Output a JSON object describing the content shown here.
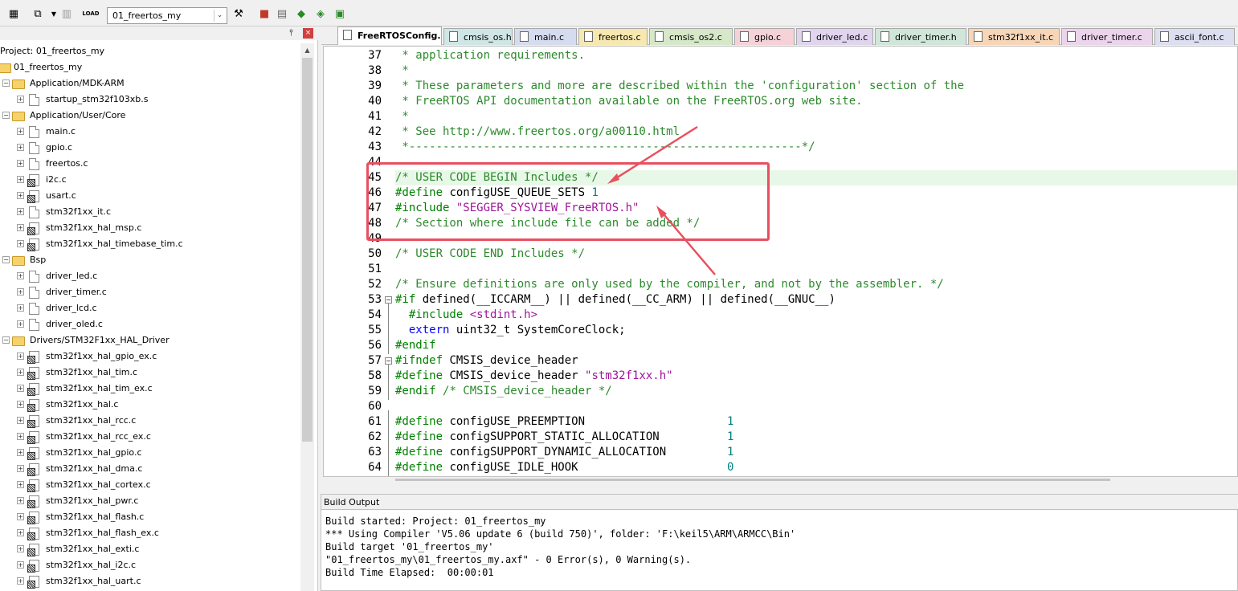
{
  "toolbar": {
    "target": "01_freertos_my",
    "icons": [
      "translate-icon",
      "build-icon",
      "rebuild-icon",
      "batch-icon",
      "load-icon",
      "target-options-icon",
      "manage-icon",
      "select-packs-icon",
      "pack-installer-icon",
      "run-icon",
      "extra-icon"
    ],
    "load_label": "LOAD"
  },
  "project": {
    "title": "Project: 01_freertos_my",
    "root": "01_freertos_my",
    "pin": "ᵠ",
    "close": "×",
    "items": [
      {
        "label": "Application/MDK-ARM",
        "type": "group"
      },
      {
        "label": "startup_stm32f103xb.s",
        "type": "file"
      },
      {
        "label": "Application/User/Core",
        "type": "group"
      },
      {
        "label": "main.c",
        "type": "file"
      },
      {
        "label": "gpio.c",
        "type": "file"
      },
      {
        "label": "freertos.c",
        "type": "file"
      },
      {
        "label": "i2c.c",
        "type": "filekey"
      },
      {
        "label": "usart.c",
        "type": "filekey"
      },
      {
        "label": "stm32f1xx_it.c",
        "type": "file"
      },
      {
        "label": "stm32f1xx_hal_msp.c",
        "type": "filekey"
      },
      {
        "label": "stm32f1xx_hal_timebase_tim.c",
        "type": "filekey"
      },
      {
        "label": "Bsp",
        "type": "group"
      },
      {
        "label": "driver_led.c",
        "type": "file"
      },
      {
        "label": "driver_timer.c",
        "type": "file"
      },
      {
        "label": "driver_lcd.c",
        "type": "file"
      },
      {
        "label": "driver_oled.c",
        "type": "file"
      },
      {
        "label": "Drivers/STM32F1xx_HAL_Driver",
        "type": "group"
      },
      {
        "label": "stm32f1xx_hal_gpio_ex.c",
        "type": "filekey"
      },
      {
        "label": "stm32f1xx_hal_tim.c",
        "type": "filekey"
      },
      {
        "label": "stm32f1xx_hal_tim_ex.c",
        "type": "filekey"
      },
      {
        "label": "stm32f1xx_hal.c",
        "type": "filekey"
      },
      {
        "label": "stm32f1xx_hal_rcc.c",
        "type": "filekey"
      },
      {
        "label": "stm32f1xx_hal_rcc_ex.c",
        "type": "filekey"
      },
      {
        "label": "stm32f1xx_hal_gpio.c",
        "type": "filekey"
      },
      {
        "label": "stm32f1xx_hal_dma.c",
        "type": "filekey"
      },
      {
        "label": "stm32f1xx_hal_cortex.c",
        "type": "filekey"
      },
      {
        "label": "stm32f1xx_hal_pwr.c",
        "type": "filekey"
      },
      {
        "label": "stm32f1xx_hal_flash.c",
        "type": "filekey"
      },
      {
        "label": "stm32f1xx_hal_flash_ex.c",
        "type": "filekey"
      },
      {
        "label": "stm32f1xx_hal_exti.c",
        "type": "filekey"
      },
      {
        "label": "stm32f1xx_hal_i2c.c",
        "type": "filekey"
      },
      {
        "label": "stm32f1xx_hal_uart.c",
        "type": "filekey"
      }
    ]
  },
  "tabs": [
    {
      "label": "FreeRTOSConfig.h",
      "color": "#ffffff",
      "active": true
    },
    {
      "label": "cmsis_os.h",
      "color": "#cfe6e6"
    },
    {
      "label": "main.c",
      "color": "#d6dcef"
    },
    {
      "label": "freertos.c",
      "color": "#f7e8b0"
    },
    {
      "label": "cmsis_os2.c",
      "color": "#d6e8c8"
    },
    {
      "label": "gpio.c",
      "color": "#f4d2d8"
    },
    {
      "label": "driver_led.c",
      "color": "#e0d4ee"
    },
    {
      "label": "driver_timer.h",
      "color": "#cfe6d8"
    },
    {
      "label": "stm32f1xx_it.c",
      "color": "#f7d6b8"
    },
    {
      "label": "driver_timer.c",
      "color": "#ecd4ec"
    },
    {
      "label": "ascii_font.c",
      "color": "#dcdff0"
    }
  ],
  "code": [
    {
      "n": "37",
      "t": [
        [
          "c-com",
          " * application requirements."
        ]
      ]
    },
    {
      "n": "38",
      "t": [
        [
          "c-com",
          " *"
        ]
      ]
    },
    {
      "n": "39",
      "t": [
        [
          "c-com",
          " * These parameters and more are described within the 'configuration' section of the"
        ]
      ]
    },
    {
      "n": "40",
      "t": [
        [
          "c-com",
          " * FreeRTOS API documentation available on the FreeRTOS.org web site."
        ]
      ]
    },
    {
      "n": "41",
      "t": [
        [
          "c-com",
          " *"
        ]
      ]
    },
    {
      "n": "42",
      "t": [
        [
          "c-com",
          " * See http://www.freertos.org/a00110.html"
        ]
      ]
    },
    {
      "n": "43",
      "t": [
        [
          "c-com",
          " *----------------------------------------------------------*/"
        ]
      ]
    },
    {
      "n": "44",
      "t": []
    },
    {
      "n": "45",
      "t": [
        [
          "c-com",
          "/* USER CODE BEGIN Includes */"
        ]
      ],
      "hl": true
    },
    {
      "n": "46",
      "t": [
        [
          "c-pp",
          "#define "
        ],
        [
          "c-tx",
          "configUSE_QUEUE_SETS "
        ],
        [
          "c-num",
          "1"
        ]
      ]
    },
    {
      "n": "47",
      "t": [
        [
          "c-pp",
          "#include "
        ],
        [
          "c-str",
          "\"SEGGER_SYSVIEW_FreeRTOS.h\""
        ]
      ]
    },
    {
      "n": "48",
      "t": [
        [
          "c-com",
          "/* Section where include file can be added */"
        ]
      ]
    },
    {
      "n": "49",
      "t": []
    },
    {
      "n": "50",
      "t": [
        [
          "c-com",
          "/* USER CODE END Includes */"
        ]
      ]
    },
    {
      "n": "51",
      "t": []
    },
    {
      "n": "52",
      "t": [
        [
          "c-com",
          "/* Ensure definitions are only used by the compiler, and not by the assembler. */"
        ]
      ]
    },
    {
      "n": "53",
      "t": [
        [
          "c-pp",
          "#if "
        ],
        [
          "c-tx",
          "defined(__ICCARM__) || defined(__CC_ARM) || defined(__GNUC__)"
        ]
      ]
    },
    {
      "n": "54",
      "t": [
        [
          "c-pp",
          "  #include "
        ],
        [
          "c-str",
          "<stdint.h>"
        ]
      ]
    },
    {
      "n": "55",
      "t": [
        [
          "c-kw",
          "  extern "
        ],
        [
          "c-tx",
          "uint32_t SystemCoreClock;"
        ]
      ]
    },
    {
      "n": "56",
      "t": [
        [
          "c-pp",
          "#endif"
        ]
      ]
    },
    {
      "n": "57",
      "t": [
        [
          "c-pp",
          "#ifndef "
        ],
        [
          "c-tx",
          "CMSIS_device_header"
        ]
      ]
    },
    {
      "n": "58",
      "t": [
        [
          "c-pp",
          "#define "
        ],
        [
          "c-tx",
          "CMSIS_device_header "
        ],
        [
          "c-str",
          "\"stm32f1xx.h\""
        ]
      ]
    },
    {
      "n": "59",
      "t": [
        [
          "c-pp",
          "#endif "
        ],
        [
          "c-com",
          "/* CMSIS_device_header */"
        ]
      ]
    },
    {
      "n": "60",
      "t": []
    },
    {
      "n": "61",
      "t": [
        [
          "c-pp",
          "#define "
        ],
        [
          "c-tx",
          "configUSE_PREEMPTION                     "
        ],
        [
          "c-num",
          "1"
        ]
      ]
    },
    {
      "n": "62",
      "t": [
        [
          "c-pp",
          "#define "
        ],
        [
          "c-tx",
          "configSUPPORT_STATIC_ALLOCATION          "
        ],
        [
          "c-num",
          "1"
        ]
      ]
    },
    {
      "n": "63",
      "t": [
        [
          "c-pp",
          "#define "
        ],
        [
          "c-tx",
          "configSUPPORT_DYNAMIC_ALLOCATION         "
        ],
        [
          "c-num",
          "1"
        ]
      ]
    },
    {
      "n": "64",
      "t": [
        [
          "c-pp",
          "#define "
        ],
        [
          "c-tx",
          "configUSE_IDLE_HOOK                      "
        ],
        [
          "c-num",
          "0"
        ]
      ]
    }
  ],
  "build": {
    "title": "Build Output",
    "lines": [
      "Build started: Project: 01_freertos_my",
      "*** Using Compiler 'V5.06 update 6 (build 750)', folder: 'F:\\keil5\\ARM\\ARMCC\\Bin'",
      "Build target '01_freertos_my'",
      "\"01_freertos_my\\01_freertos_my.axf\" - 0 Error(s), 0 Warning(s).",
      "Build Time Elapsed:  00:00:01"
    ]
  },
  "annotation": {
    "color": "#e8505f"
  }
}
